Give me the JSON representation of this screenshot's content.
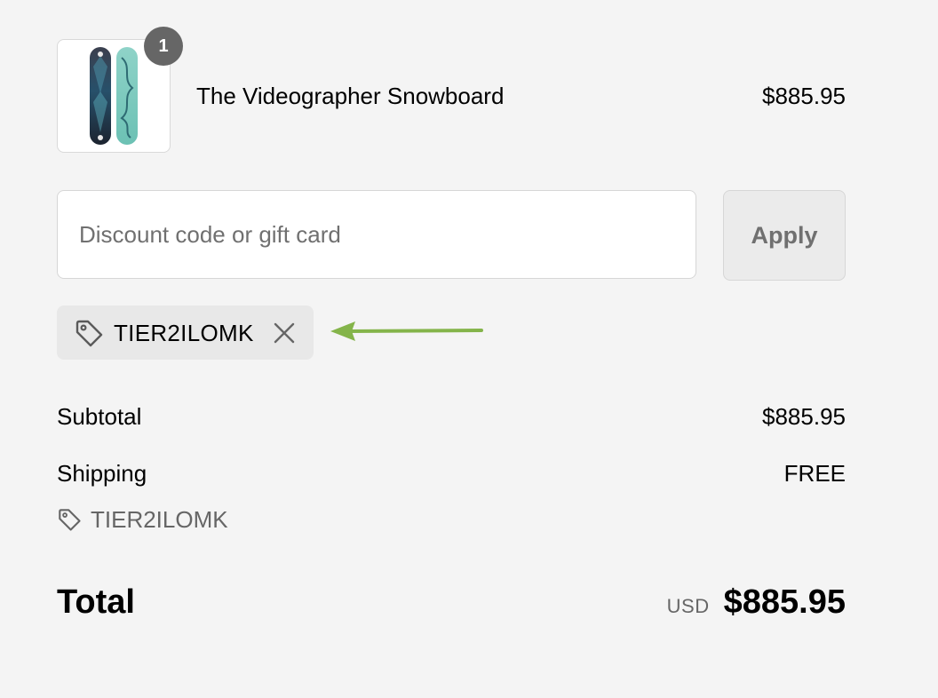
{
  "line_item": {
    "quantity": "1",
    "title": "The Videographer Snowboard",
    "price": "$885.95",
    "image_icon": "snowboard-image"
  },
  "discount": {
    "placeholder": "Discount code or gift card",
    "value": "",
    "apply_label": "Apply"
  },
  "applied_code": {
    "code": "TIER2ILOMK",
    "tag_icon": "tag-icon",
    "remove_icon": "close-icon"
  },
  "annotation": {
    "arrow_icon": "arrow-left-icon",
    "arrow_color": "#84b44a"
  },
  "summary": {
    "subtotal_label": "Subtotal",
    "subtotal_value": "$885.95",
    "shipping_label": "Shipping",
    "shipping_value": "FREE",
    "discount_code": "TIER2ILOMK"
  },
  "total": {
    "label": "Total",
    "currency": "USD",
    "amount": "$885.95"
  },
  "colors": {
    "background": "#f4f4f4",
    "badge": "#666666",
    "chip": "#e8e8e8",
    "apply_button": "#ebebeb"
  }
}
